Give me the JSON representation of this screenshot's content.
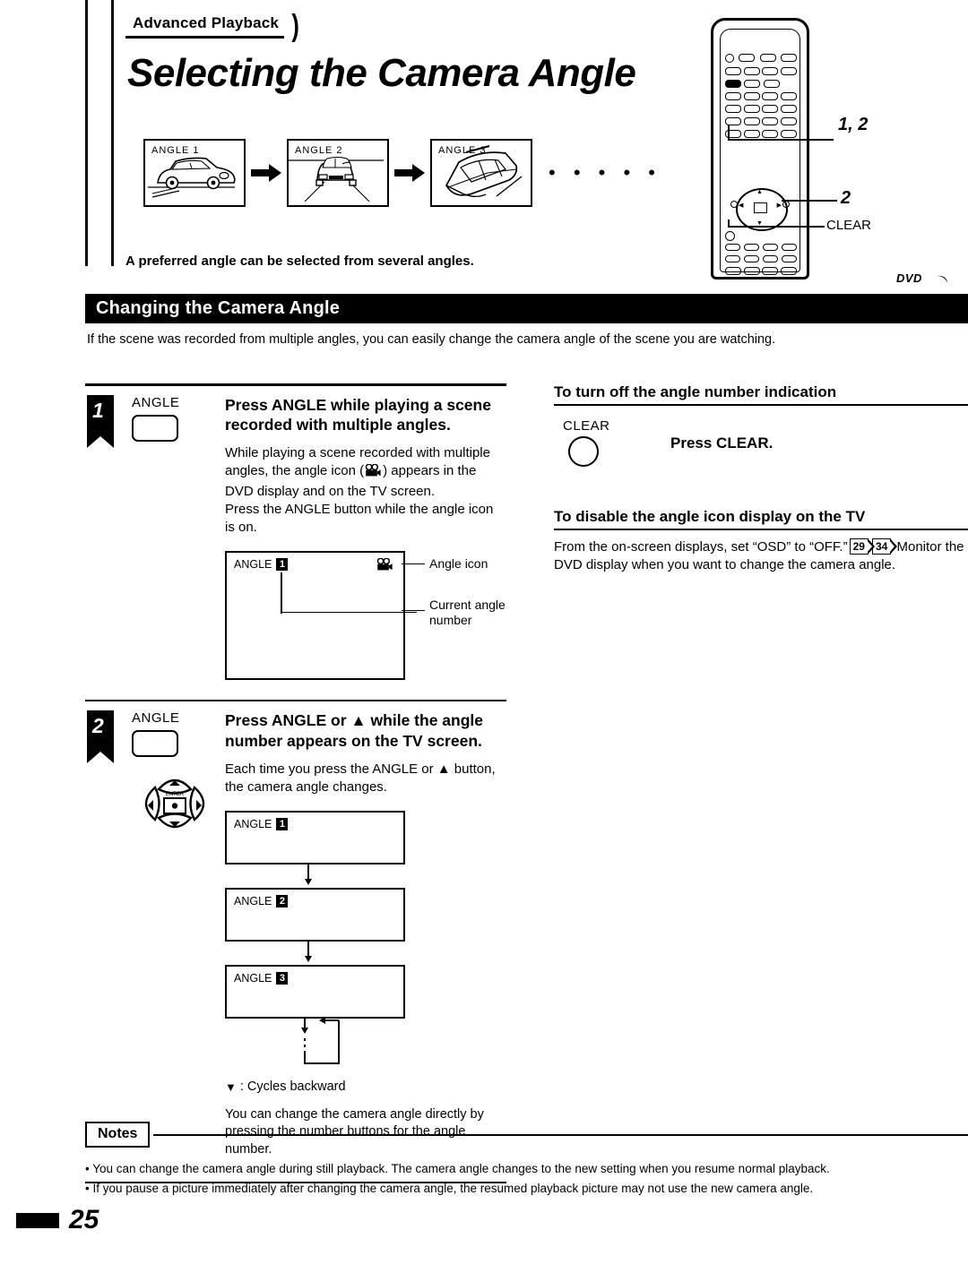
{
  "header": {
    "category_tab": "Advanced Playback",
    "title": "Selecting the Camera Angle",
    "lead": "A preferred angle can be selected from several angles.",
    "thumbnails": [
      {
        "label": "ANGLE  1",
        "view": "side-view-car"
      },
      {
        "label": "ANGLE  2",
        "view": "front-view-car"
      },
      {
        "label": "ANGLE  3",
        "view": "top-rear-view-car"
      }
    ],
    "continuation_dots": "• • • • •"
  },
  "remote": {
    "callout_top": "1, 2",
    "callout_pad": "2",
    "callout_clear": "CLEAR",
    "badge": "DVD"
  },
  "section": {
    "bar_title": "Changing the Camera Angle",
    "intro": "If the scene was recorded from multiple angles, you can easily change the camera angle of the scene you are watching."
  },
  "steps": [
    {
      "number": "1",
      "key_label": "ANGLE",
      "title": "Press ANGLE while playing a scene recorded with multiple angles.",
      "body_part1": "While playing a scene recorded with multiple angles, the angle icon (",
      "body_part2": ") appears in the DVD display and on the TV screen.",
      "body_part3": "Press the ANGLE button while the angle icon is on.",
      "figure": {
        "osd_label": "ANGLE",
        "osd_number": "1",
        "callout_icon": "Angle icon",
        "callout_number_line1": "Current angle",
        "callout_number_line2": "number"
      }
    },
    {
      "number": "2",
      "key_label": "ANGLE",
      "title": "Press ANGLE or ▲ while the angle number appears on the TV screen.",
      "body": "Each time you press the ANGLE or ▲ button, the camera angle changes.",
      "dpad_center_label": "ENTER",
      "cycle": [
        {
          "label": "ANGLE",
          "number": "1"
        },
        {
          "label": "ANGLE",
          "number": "2"
        },
        {
          "label": "ANGLE",
          "number": "3"
        }
      ],
      "cycle_legend": ": Cycles backward",
      "cycle_legend_symbol": "▼",
      "extra_note": "You can change the camera angle directly by pressing the number buttons for the angle number."
    }
  ],
  "right_column": {
    "sub1": {
      "heading": "To turn off the angle number indication",
      "key_label": "CLEAR",
      "instruction": "Press CLEAR."
    },
    "sub2": {
      "heading": "To disable the angle icon display on the TV",
      "body_part1": "From the on-screen displays, set “OSD” to “OFF.”",
      "pagerefs": [
        "29",
        "34"
      ],
      "body_part2": "Monitor the DVD display when you want to change the camera angle."
    }
  },
  "notes": {
    "heading": "Notes",
    "items": [
      "• You can change the camera angle during still playback. The camera angle changes to the new setting when you resume normal playback.",
      "• If you pause a picture immediately after changing the camera angle, the resumed playback picture may not use the new camera angle."
    ]
  },
  "footer": {
    "page_number": "25"
  }
}
